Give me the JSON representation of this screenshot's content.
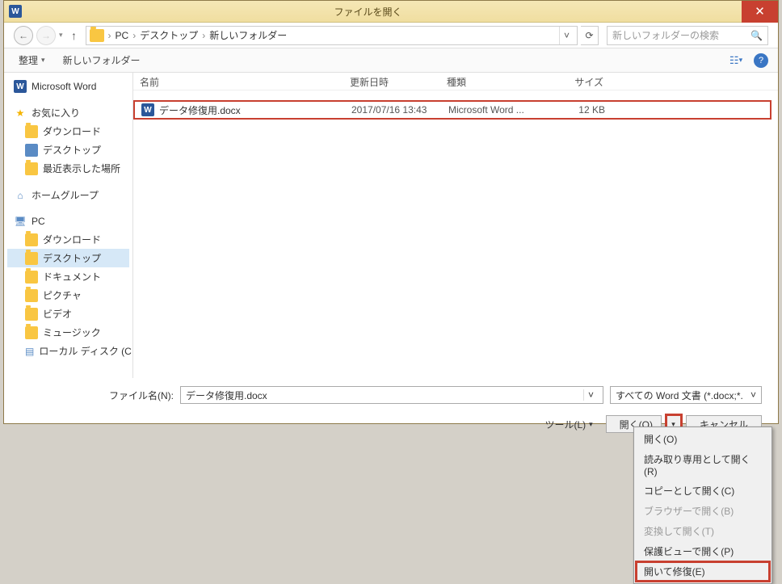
{
  "title": "ファイルを開く",
  "breadcrumb": {
    "p1": "PC",
    "p2": "デスクトップ",
    "p3": "新しいフォルダー"
  },
  "search": {
    "placeholder": "新しいフォルダーの検索"
  },
  "toolbar": {
    "organize": "整理",
    "newFolder": "新しいフォルダー"
  },
  "sidebar": {
    "word": "Microsoft Word",
    "fav": "お気に入り",
    "favItems": [
      "ダウンロード",
      "デスクトップ",
      "最近表示した場所"
    ],
    "homegroup": "ホームグループ",
    "pc": "PC",
    "pcItems": [
      "ダウンロード",
      "デスクトップ",
      "ドキュメント",
      "ピクチャ",
      "ビデオ",
      "ミュージック",
      "ローカル ディスク (C"
    ]
  },
  "columns": {
    "name": "名前",
    "date": "更新日時",
    "type": "種類",
    "size": "サイズ"
  },
  "file": {
    "name": "データ修復用.docx",
    "date": "2017/07/16 13:43",
    "type": "Microsoft Word ...",
    "size": "12 KB"
  },
  "bottom": {
    "fileLabel": "ファイル名(N):",
    "fileName": "データ修復用.docx",
    "filter": "すべての Word 文書 (*.docx;*.",
    "tools": "ツール(L)",
    "open": "開く(O)",
    "cancel": "キャンセル"
  },
  "menu": {
    "items": [
      {
        "label": "開く(O)",
        "disabled": false
      },
      {
        "label": "読み取り専用として開く(R)",
        "disabled": false
      },
      {
        "label": "コピーとして開く(C)",
        "disabled": false
      },
      {
        "label": "ブラウザーで開く(B)",
        "disabled": true
      },
      {
        "label": "変換して開く(T)",
        "disabled": true
      },
      {
        "label": "保護ビューで開く(P)",
        "disabled": false
      },
      {
        "label": "開いて修復(E)",
        "disabled": false
      }
    ]
  }
}
